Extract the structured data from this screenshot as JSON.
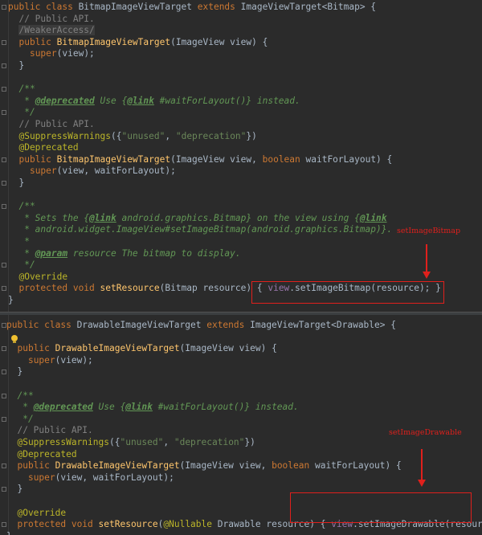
{
  "colors": {
    "background": "#2b2b2b",
    "keyword": "#cc7832",
    "comment": "#808080",
    "javadoc": "#629755",
    "string": "#6a8759",
    "annotation": "#bbb529",
    "method_declaration": "#ffc66d",
    "field": "#9876aa",
    "plain_text": "#a9b7c6",
    "callout_red": "#e0201c"
  },
  "pane_top": {
    "lines": [
      [
        {
          "t": "public class ",
          "c": "kw"
        },
        {
          "t": "BitmapImageViewTarget ",
          "c": "plain"
        },
        {
          "t": "extends ",
          "c": "kw"
        },
        {
          "t": "ImageViewTarget<Bitmap> {",
          "c": "plain"
        }
      ],
      [
        {
          "t": "  // Public API.",
          "c": "cmt"
        }
      ],
      [
        {
          "t": "  ",
          "c": "plain"
        },
        {
          "t": "/WeakerAccess/",
          "c": "weak"
        }
      ],
      [
        {
          "t": "  ",
          "c": "plain"
        },
        {
          "t": "public ",
          "c": "kw"
        },
        {
          "t": "BitmapImageViewTarget",
          "c": "meth"
        },
        {
          "t": "(ImageView view) {",
          "c": "plain"
        }
      ],
      [
        {
          "t": "    ",
          "c": "plain"
        },
        {
          "t": "super",
          "c": "kw"
        },
        {
          "t": "(view);",
          "c": "plain"
        }
      ],
      [
        {
          "t": "  }",
          "c": "plain"
        }
      ],
      [],
      [
        {
          "t": "  /**",
          "c": "doc"
        }
      ],
      [
        {
          "t": "   * ",
          "c": "doc"
        },
        {
          "t": "@deprecated",
          "c": "doctag"
        },
        {
          "t": " Use {",
          "c": "doc"
        },
        {
          "t": "@link",
          "c": "doctag"
        },
        {
          "t": " #waitForLayout()} instead.",
          "c": "doc"
        }
      ],
      [
        {
          "t": "   */",
          "c": "doc"
        }
      ],
      [
        {
          "t": "  // Public API.",
          "c": "cmt"
        }
      ],
      [
        {
          "t": "  @SuppressWarnings",
          "c": "ann"
        },
        {
          "t": "({",
          "c": "plain"
        },
        {
          "t": "\"unused\"",
          "c": "str"
        },
        {
          "t": ", ",
          "c": "plain"
        },
        {
          "t": "\"deprecation\"",
          "c": "str"
        },
        {
          "t": "})",
          "c": "plain"
        }
      ],
      [
        {
          "t": "  @Deprecated",
          "c": "ann"
        }
      ],
      [
        {
          "t": "  ",
          "c": "plain"
        },
        {
          "t": "public ",
          "c": "kw"
        },
        {
          "t": "BitmapImageViewTarget",
          "c": "meth"
        },
        {
          "t": "(ImageView view, ",
          "c": "plain"
        },
        {
          "t": "boolean ",
          "c": "kw"
        },
        {
          "t": "waitForLayout) {",
          "c": "plain"
        }
      ],
      [
        {
          "t": "    ",
          "c": "plain"
        },
        {
          "t": "super",
          "c": "kw"
        },
        {
          "t": "(view, waitForLayout);",
          "c": "plain"
        }
      ],
      [
        {
          "t": "  }",
          "c": "plain"
        }
      ],
      [],
      [
        {
          "t": "  /**",
          "c": "doc"
        }
      ],
      [
        {
          "t": "   * Sets the {",
          "c": "doc"
        },
        {
          "t": "@link",
          "c": "doctag"
        },
        {
          "t": " android.graphics.Bitmap} on the view using {",
          "c": "doc"
        },
        {
          "t": "@link",
          "c": "doctag"
        }
      ],
      [
        {
          "t": "   * android.widget.ImageView#setImageBitmap(android.graphics.Bitmap)}.",
          "c": "doc"
        }
      ],
      [
        {
          "t": "   *",
          "c": "doc"
        }
      ],
      [
        {
          "t": "   * ",
          "c": "doc"
        },
        {
          "t": "@param",
          "c": "doctag"
        },
        {
          "t": " resource The bitmap to display.",
          "c": "doc"
        }
      ],
      [
        {
          "t": "   */",
          "c": "doc"
        }
      ],
      [
        {
          "t": "  @Override",
          "c": "ann"
        }
      ],
      [
        {
          "t": "  ",
          "c": "plain"
        },
        {
          "t": "protected void ",
          "c": "kw"
        },
        {
          "t": "setResource",
          "c": "meth"
        },
        {
          "t": "(Bitmap resource) { ",
          "c": "plain"
        },
        {
          "t": "view",
          "c": "field"
        },
        {
          "t": ".setImageBitmap(resource); }",
          "c": "plain"
        }
      ],
      [
        {
          "t": "}",
          "c": "plain"
        }
      ]
    ],
    "callout_label": "setImageBitmap"
  },
  "pane_bottom": {
    "lines": [
      [
        {
          "t": "public class ",
          "c": "kw"
        },
        {
          "t": "DrawableImageViewTarget ",
          "c": "plain"
        },
        {
          "t": "extends ",
          "c": "kw"
        },
        {
          "t": "ImageViewTarget<Drawable> {",
          "c": "plain"
        }
      ],
      [],
      [
        {
          "t": "  ",
          "c": "plain"
        },
        {
          "t": "public ",
          "c": "kw"
        },
        {
          "t": "DrawableImageViewTarget",
          "c": "meth"
        },
        {
          "t": "(ImageView view) {",
          "c": "plain"
        }
      ],
      [
        {
          "t": "    ",
          "c": "plain"
        },
        {
          "t": "super",
          "c": "kw"
        },
        {
          "t": "(view);",
          "c": "plain"
        }
      ],
      [
        {
          "t": "  }",
          "c": "plain"
        }
      ],
      [],
      [
        {
          "t": "  /**",
          "c": "doc"
        }
      ],
      [
        {
          "t": "   * ",
          "c": "doc"
        },
        {
          "t": "@deprecated",
          "c": "doctag"
        },
        {
          "t": " Use {",
          "c": "doc"
        },
        {
          "t": "@link",
          "c": "doctag"
        },
        {
          "t": " #waitForLayout()} instead.",
          "c": "doc"
        }
      ],
      [
        {
          "t": "   */",
          "c": "doc"
        }
      ],
      [
        {
          "t": "  // Public API.",
          "c": "cmt"
        }
      ],
      [
        {
          "t": "  @SuppressWarnings",
          "c": "ann"
        },
        {
          "t": "({",
          "c": "plain"
        },
        {
          "t": "\"unused\"",
          "c": "str"
        },
        {
          "t": ", ",
          "c": "plain"
        },
        {
          "t": "\"deprecation\"",
          "c": "str"
        },
        {
          "t": "})",
          "c": "plain"
        }
      ],
      [
        {
          "t": "  @Deprecated",
          "c": "ann"
        }
      ],
      [
        {
          "t": "  ",
          "c": "plain"
        },
        {
          "t": "public ",
          "c": "kw"
        },
        {
          "t": "DrawableImageViewTarget",
          "c": "meth"
        },
        {
          "t": "(ImageView view, ",
          "c": "plain"
        },
        {
          "t": "boolean ",
          "c": "kw"
        },
        {
          "t": "waitForLayout) {",
          "c": "plain"
        }
      ],
      [
        {
          "t": "    ",
          "c": "plain"
        },
        {
          "t": "super",
          "c": "kw"
        },
        {
          "t": "(view, waitForLayout);",
          "c": "plain"
        }
      ],
      [
        {
          "t": "  }",
          "c": "plain"
        }
      ],
      [],
      [
        {
          "t": "  @Override",
          "c": "ann"
        }
      ],
      [
        {
          "t": "  ",
          "c": "plain"
        },
        {
          "t": "protected void ",
          "c": "kw"
        },
        {
          "t": "setResource",
          "c": "meth"
        },
        {
          "t": "(",
          "c": "plain"
        },
        {
          "t": "@Nullable ",
          "c": "ann"
        },
        {
          "t": "Drawable resource) { ",
          "c": "plain"
        },
        {
          "t": "view",
          "c": "field"
        },
        {
          "t": ".setImageDrawable(resource); }",
          "c": "plain"
        }
      ],
      [
        {
          "t": "}",
          "c": "plain"
        }
      ]
    ],
    "callout_label": "setImageDrawable"
  }
}
